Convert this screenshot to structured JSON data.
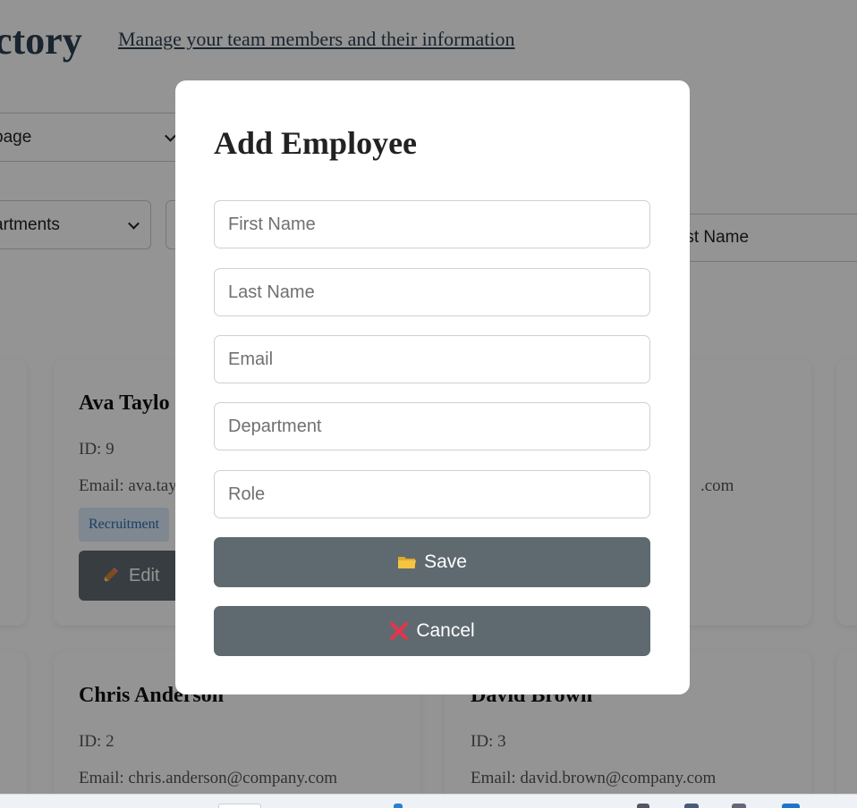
{
  "header": {
    "title": "ctory",
    "subtitle": "Manage your team members and their information"
  },
  "controls": {
    "per_page_value": "page",
    "department_value": "artments",
    "sort_value": "rst Name"
  },
  "cards": [
    {
      "name": "Ava Taylo",
      "id_text": "ID: 9",
      "email_text": "Email: ava.tay",
      "tag": "Recruitment",
      "edit_label": "Edit"
    },
    {
      "email_tail": ".com"
    },
    {
      "name": "Chris Anderson",
      "id_text": "ID: 2",
      "email_text": "Email: chris.anderson@company.com"
    },
    {
      "name": "David Brown",
      "id_text": "ID: 3",
      "email_text": "Email: david.brown@company.com"
    }
  ],
  "modal": {
    "title": "Add Employee",
    "fields": [
      {
        "placeholder": "First Name",
        "value": ""
      },
      {
        "placeholder": "Last Name",
        "value": ""
      },
      {
        "placeholder": "Email",
        "value": ""
      },
      {
        "placeholder": "Department",
        "value": ""
      },
      {
        "placeholder": "Role",
        "value": ""
      }
    ],
    "save_label": "Save",
    "save_icon": "folder-icon",
    "cancel_label": "Cancel",
    "cancel_icon": "cross-mark-icon"
  },
  "colors": {
    "button_bg": "#5f6a70",
    "title_color": "#2c3e50",
    "tag_bg": "#dbe9f9",
    "tag_text": "#2a6db0",
    "cancel_icon": "#e8334a",
    "folder_icon": "#f5c542"
  }
}
